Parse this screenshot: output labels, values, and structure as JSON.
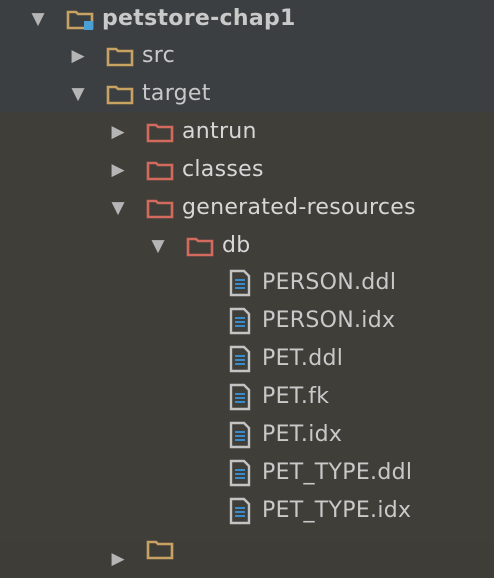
{
  "tree": {
    "root": {
      "label": "petstore-chap1"
    },
    "src": {
      "label": "src"
    },
    "target": {
      "label": "target"
    },
    "antrun": {
      "label": "antrun"
    },
    "classes": {
      "label": "classes"
    },
    "generated": {
      "label": "generated-resources"
    },
    "db": {
      "label": "db"
    },
    "files": [
      {
        "label": "PERSON.ddl"
      },
      {
        "label": "PERSON.idx"
      },
      {
        "label": "PET.ddl"
      },
      {
        "label": "PET.fk"
      },
      {
        "label": "PET.idx"
      },
      {
        "label": "PET_TYPE.ddl"
      },
      {
        "label": "PET_TYPE.idx"
      }
    ]
  },
  "icons": {
    "expanded": "triangle-down",
    "collapsed": "triangle-right",
    "module": "module-folder-icon",
    "folder": "folder-icon",
    "excluded_folder": "excluded-folder-icon",
    "file": "text-file-icon"
  },
  "colors": {
    "folder": "#c8a262",
    "excluded_folder": "#d26a5e",
    "module_badge": "#4a9fd5",
    "file_icon": "#c3c3c3",
    "file_lines": "#3a8ad0",
    "text": "#c9c9c9",
    "top_background": "#3c3f41",
    "target_background": "#403e39"
  }
}
